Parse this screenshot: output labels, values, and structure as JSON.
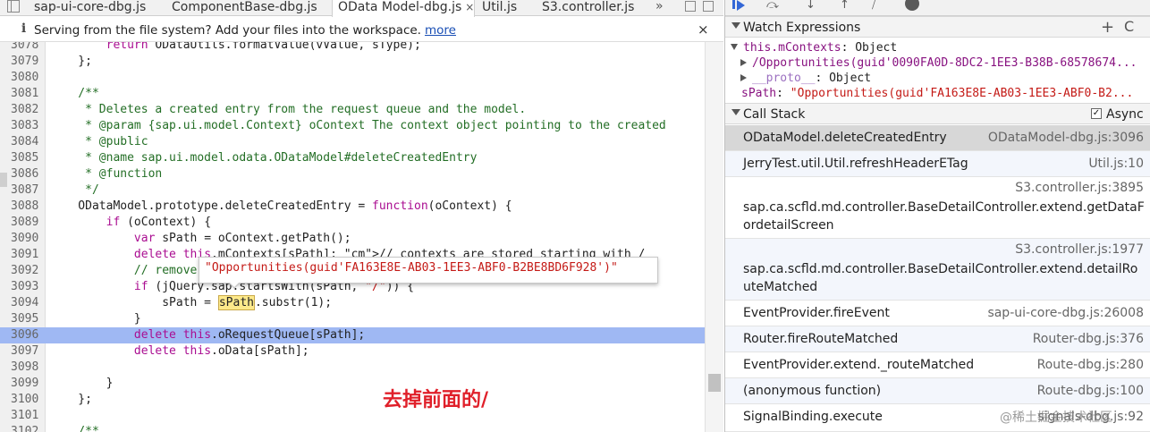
{
  "tabs": [
    {
      "label": "sap-ui-core-dbg.js",
      "active": false
    },
    {
      "label": "ComponentBase-dbg.js",
      "active": false
    },
    {
      "label": "OData Model-dbg.js",
      "active": true
    },
    {
      "label": "Util.js",
      "active": false
    },
    {
      "label": "S3.controller.js",
      "active": false
    }
  ],
  "tabs_more": "»",
  "infobar": {
    "message": "Serving from the file system? Add your files into the workspace.",
    "link": "more",
    "close": "×"
  },
  "code_lines": [
    {
      "n": "3078",
      "text": "        return ODataUtils.formatValue(vValue, sType);"
    },
    {
      "n": "3079",
      "text": "    };"
    },
    {
      "n": "3080",
      "text": ""
    },
    {
      "n": "3081",
      "text": "    /**"
    },
    {
      "n": "3082",
      "text": "     * Deletes a created entry from the request queue and the model."
    },
    {
      "n": "3083",
      "text": "     * @param {sap.ui.model.Context} oContext The context object pointing to the created"
    },
    {
      "n": "3084",
      "text": "     * @public"
    },
    {
      "n": "3085",
      "text": "     * @name sap.ui.model.odata.ODataModel#deleteCreatedEntry"
    },
    {
      "n": "3086",
      "text": "     * @function"
    },
    {
      "n": "3087",
      "text": "     */"
    },
    {
      "n": "3088",
      "text": "    ODataModel.prototype.deleteCreatedEntry = function(oContext) {"
    },
    {
      "n": "3089",
      "text": "        if (oContext) {"
    },
    {
      "n": "3090",
      "text": "            var sPath = oContext.getPath();"
    },
    {
      "n": "3091",
      "text": "            delete this.mContexts[sPath]; // contexts are stored starting with /"
    },
    {
      "n": "3092",
      "text": "            // remove"
    },
    {
      "n": "3093",
      "text": "            if (jQuery.sap.startsWith(sPath, \"/\")) {"
    },
    {
      "n": "3094",
      "text": "                sPath = sPath.substr(1);"
    },
    {
      "n": "3095",
      "text": "            }"
    },
    {
      "n": "3096",
      "text": "            delete this.oRequestQueue[sPath];"
    },
    {
      "n": "3097",
      "text": "            delete this.oData[sPath];"
    },
    {
      "n": "3098",
      "text": ""
    },
    {
      "n": "3099",
      "text": "        }"
    },
    {
      "n": "3100",
      "text": "    };"
    },
    {
      "n": "3101",
      "text": ""
    },
    {
      "n": "3102",
      "text": "    /**"
    }
  ],
  "highlighted_line": "3096",
  "tooltip_value": "\"Opportunities(guid'FA163E8E-AB03-1EE3-ABF0-B2BE8BD6F928')\"",
  "annotation": "去掉前面的/",
  "watch": {
    "title": "Watch Expressions",
    "add": "+",
    "refresh": "C",
    "rows": [
      {
        "key": "this.mContexts",
        "sep": ": ",
        "value": "Object"
      },
      {
        "key": "/Opportunities(guid'0090FA0D-8DC2-1EE3-B38B-68578674...",
        "sep": "",
        "value": ""
      },
      {
        "key": "__proto__",
        "sep": ": ",
        "value": "Object"
      },
      {
        "key": "sPath",
        "sep": ": ",
        "value": "\"Opportunities(guid'FA163E8E-AB03-1EE3-ABF0-B2..."
      }
    ]
  },
  "callstack": {
    "title": "Call Stack",
    "async_label": "Async",
    "async_checked": true,
    "frames": [
      {
        "name": "ODataModel.deleteCreatedEntry",
        "loc": "ODataModel-dbg.js:3096"
      },
      {
        "name": "JerryTest.util.Util.refreshHeaderETag",
        "loc": "Util.js:10"
      },
      {
        "name": "sap.ca.scfld.md.controller.BaseDetailController.extend.getDataFordetailScreen",
        "loc": "S3.controller.js:3895"
      },
      {
        "name": "sap.ca.scfld.md.controller.BaseDetailController.extend.detailRouteMatched",
        "loc": "S3.controller.js:1977"
      },
      {
        "name": "EventProvider.fireEvent",
        "loc": "sap-ui-core-dbg.js:26008"
      },
      {
        "name": "Router.fireRouteMatched",
        "loc": "Router-dbg.js:376"
      },
      {
        "name": "EventProvider.extend._routeMatched",
        "loc": "Route-dbg.js:280"
      },
      {
        "name": "(anonymous function)",
        "loc": "Route-dbg.js:100"
      },
      {
        "name": "SignalBinding.execute",
        "loc": "signals-dbg.js:92"
      }
    ]
  },
  "watermark": "@稀土掘金技术社区",
  "colors": {
    "highlight_line": "#9fb8f3",
    "selected_frame": "#d7d7d7",
    "annotation": "#e0202a",
    "string": "#c41a16",
    "keyword": "#aa0d91",
    "comment": "#236e25"
  }
}
